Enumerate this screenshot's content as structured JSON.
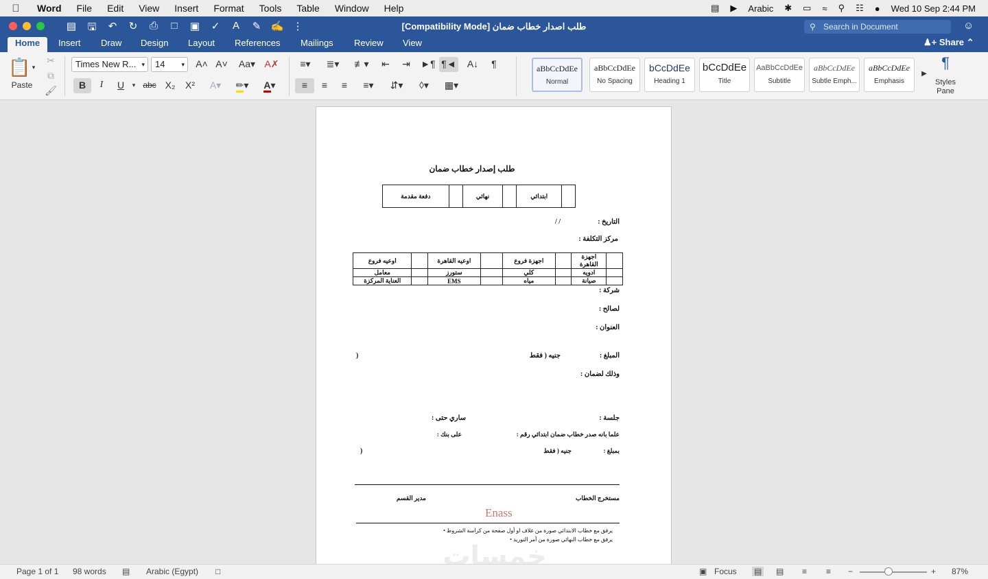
{
  "menubar": {
    "app": "Word",
    "items": [
      "File",
      "Edit",
      "View",
      "Insert",
      "Format",
      "Tools",
      "Table",
      "Window",
      "Help"
    ],
    "input_source": "Arabic",
    "datetime": "Wed 10 Sep  2:44 PM"
  },
  "window": {
    "title": "طلب اصدار خطاب ضمان [Compatibility Mode]",
    "search_placeholder": "Search in Document",
    "share_label": "Share"
  },
  "tabs": [
    "Home",
    "Insert",
    "Draw",
    "Design",
    "Layout",
    "References",
    "Mailings",
    "Review",
    "View"
  ],
  "ribbon": {
    "paste_label": "Paste",
    "font_name": "Times New R...",
    "font_size": "14",
    "styles": [
      {
        "preview": "aBbCcDdEe",
        "label": "Normal"
      },
      {
        "preview": "aBbCcDdEe",
        "label": "No Spacing"
      },
      {
        "preview": "bCcDdEe",
        "label": "Heading 1"
      },
      {
        "preview": "bCcDdEe",
        "label": "Title"
      },
      {
        "preview": "AaBbCcDdEe",
        "label": "Subtitle"
      },
      {
        "preview": "aBbCcDdEe",
        "label": "Subtle Emph..."
      },
      {
        "preview": "aBbCcDdEe",
        "label": "Emphasis"
      }
    ],
    "styles_pane_label": "Styles Pane"
  },
  "document": {
    "title": "طلب إصدار خطاب ضمان",
    "type_table": [
      "دفعة مقدمة",
      "نهائي",
      "ابتدائي"
    ],
    "date_label": "التاريخ :",
    "date_slashes": "/        /",
    "cost_center_label": "مركز التكلفة :",
    "cost_table": [
      [
        "اوعيه فروع",
        "اوعيه القاهرة",
        "اجهزة فروع",
        "اجهزة القاهرة"
      ],
      [
        "معامل",
        "ستورز",
        "كلي",
        "ادويه"
      ],
      [
        "العناية المركزة",
        "EMS",
        "مياه",
        "صيانة"
      ]
    ],
    "company_label": "شركة :",
    "beneficiary_label": "لصالح :",
    "address_label": "العنوان :",
    "amount_label": "المبلغ  :",
    "amount_currency": "جنيه ( فقط",
    "close_paren": ")",
    "guarantee_label": "وذلك لضمان :",
    "session_label": "جلسة  :",
    "valid_until_label": "ساري حتى :",
    "notice_line": "علما بانه صدر خطاب ضمان ابتدائي رقم :",
    "bank_label": "على بنك :",
    "amount2_label": "بمبلغ :",
    "amount2_currency": "جنيه ( فقط",
    "issuer_label": "مستخرج الخطاب",
    "manager_label": "مدير القسم",
    "signature": "Enass",
    "bullets": [
      "يرفق مع خطاب الابتدائي صورة من غلاف او أول صفحة من كراسة الشروط",
      "يرفق مع خطاب النهائي صورة من أمر التوريد"
    ],
    "watermark": "خمسات"
  },
  "status": {
    "page": "Page 1 of 1",
    "words": "98 words",
    "language": "Arabic (Egypt)",
    "focus": "Focus",
    "zoom": "87%"
  }
}
